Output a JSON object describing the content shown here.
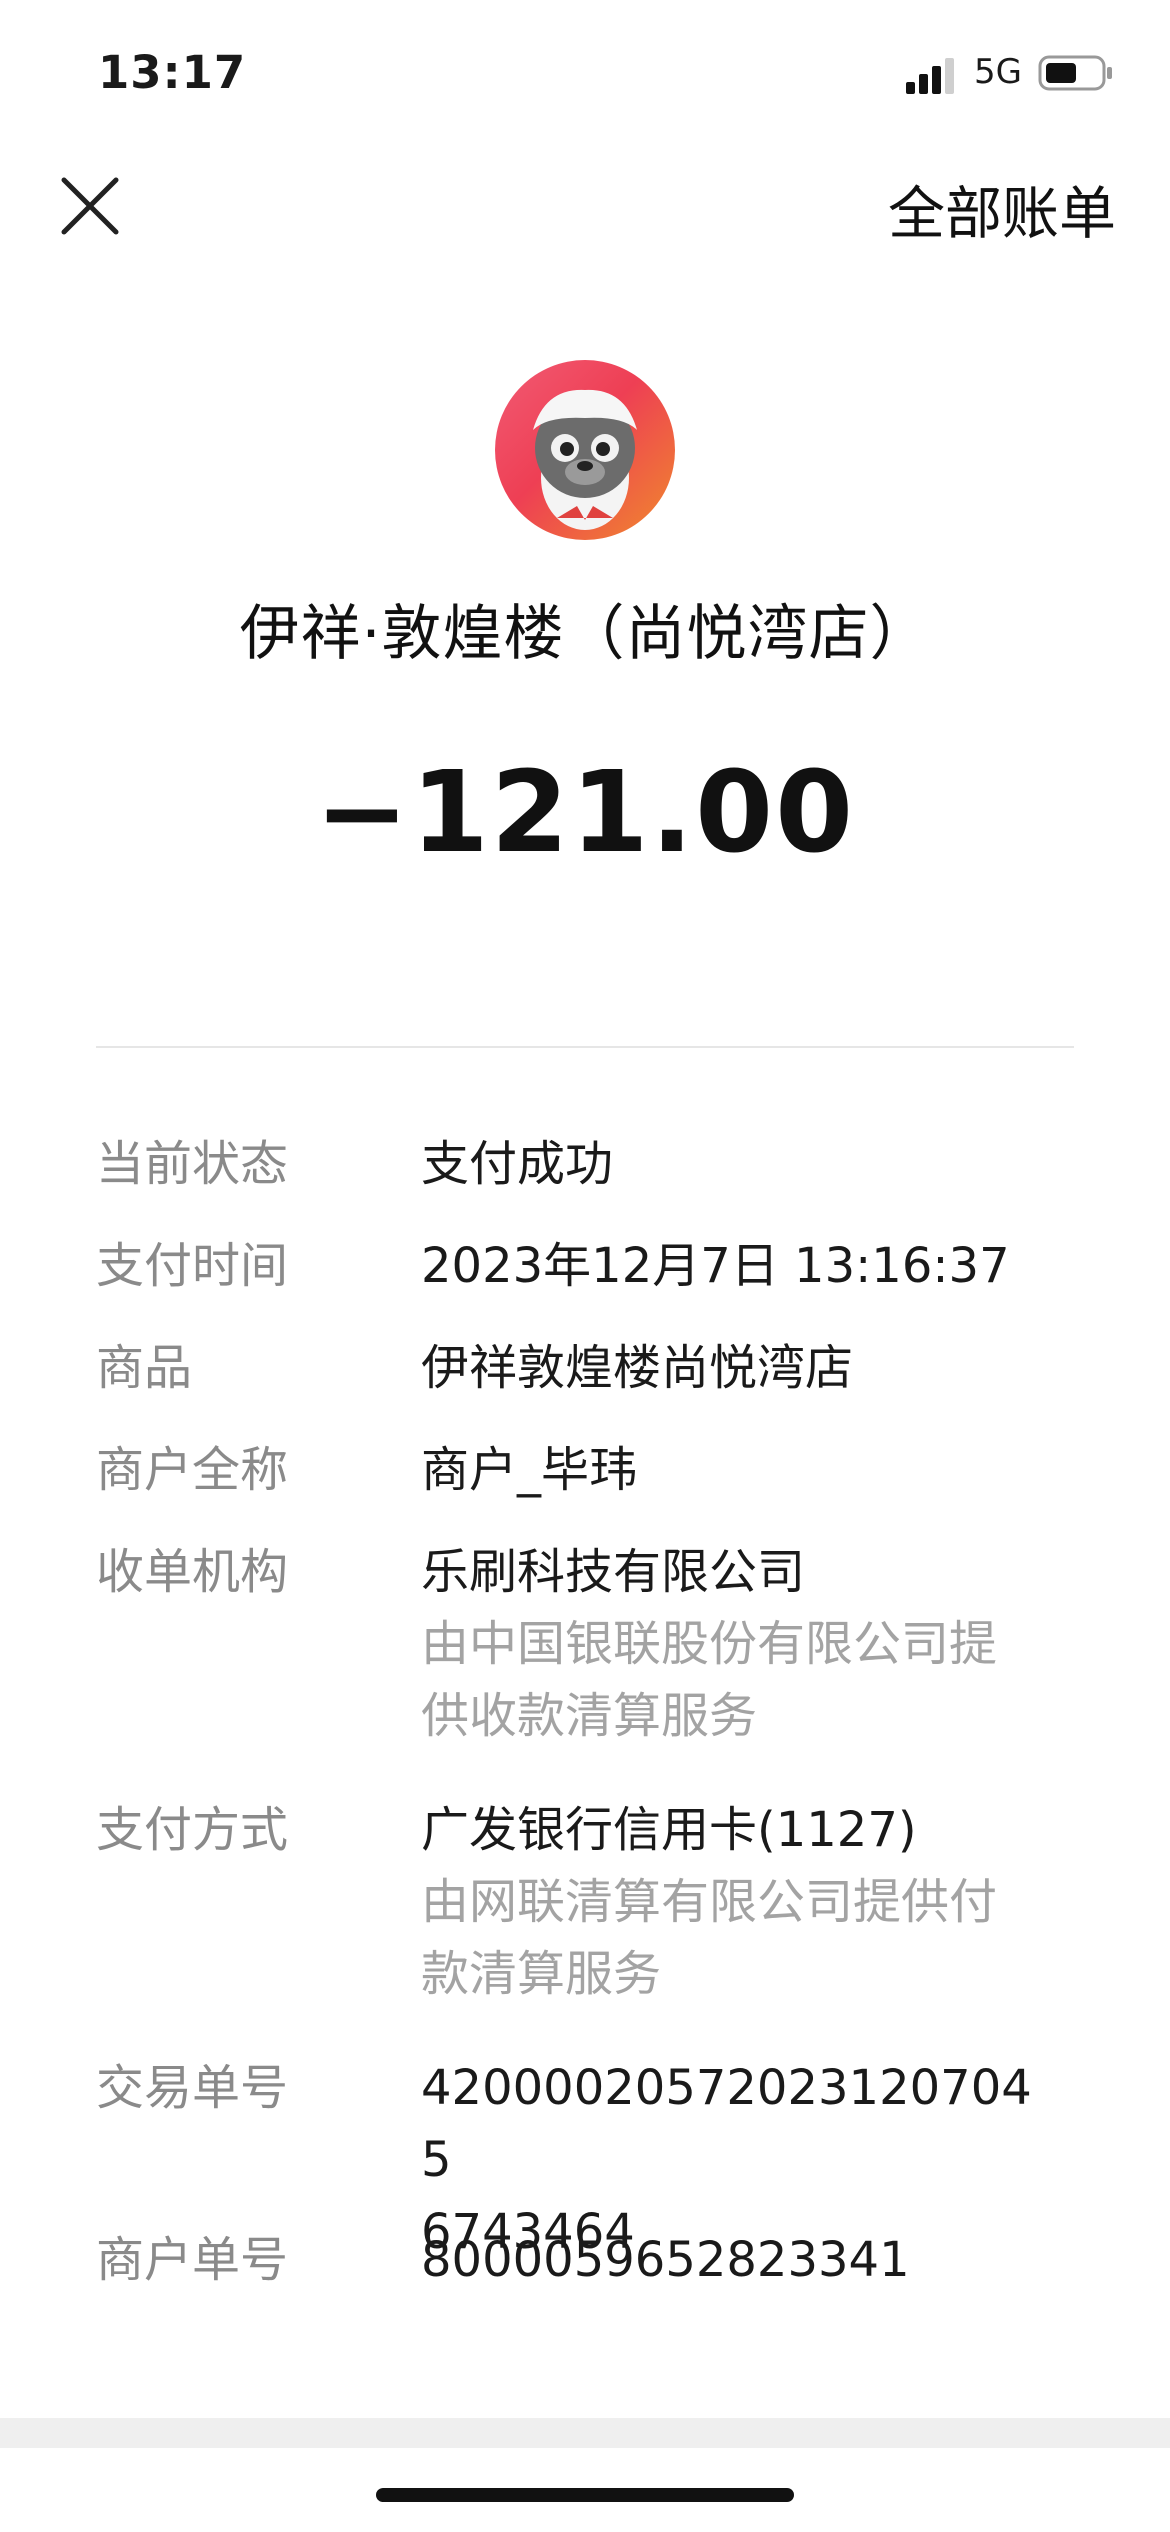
{
  "status_bar": {
    "time": "13:17",
    "network": "5G",
    "icons": [
      "signal-icon",
      "battery-icon"
    ]
  },
  "nav": {
    "close_icon": "close-icon",
    "all_bills_label": "全部账单"
  },
  "merchant": {
    "avatar": "merchant-avatar",
    "name": "伊祥·敦煌楼（尚悦湾店）"
  },
  "amount": "−121.00",
  "details": {
    "status": {
      "label": "当前状态",
      "value": "支付成功"
    },
    "pay_time": {
      "label": "支付时间",
      "value": "2023年12月7日 13:16:37"
    },
    "goods": {
      "label": "商品",
      "value": "伊祥敦煌楼尚悦湾店"
    },
    "merchant_fullname": {
      "label": "商户全称",
      "value": "商户_毕玮"
    },
    "acquirer": {
      "label": "收单机构",
      "value": "乐刷科技有限公司",
      "sub_line1": "由中国银联股份有限公司提",
      "sub_line2": "供收款清算服务"
    },
    "pay_method": {
      "label": "支付方式",
      "value": "广发银行信用卡(1127)",
      "sub_line1": "由网联清算有限公司提供付",
      "sub_line2": "款清算服务"
    },
    "transaction_no": {
      "label": "交易单号",
      "value_line1": "42000020572023120704 5",
      "value_line2": "6743464"
    },
    "merchant_no": {
      "label": "商户单号",
      "value": "8000059652823341"
    }
  }
}
